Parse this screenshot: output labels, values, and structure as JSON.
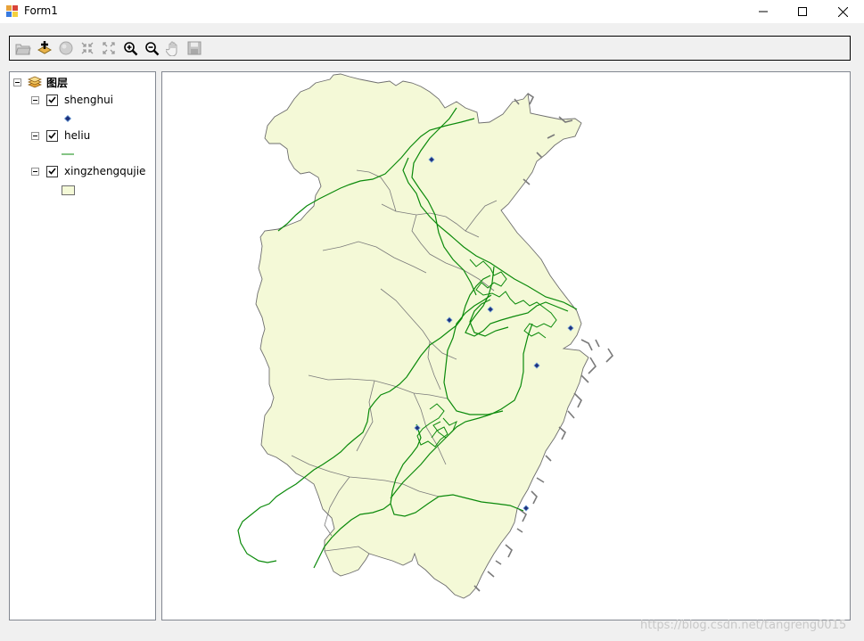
{
  "window": {
    "title": "Form1",
    "controls": {
      "minimize": "minimize",
      "maximize": "maximize",
      "close": "close"
    }
  },
  "toolbar": {
    "tools": [
      {
        "name": "open-document-icon"
      },
      {
        "name": "add-data-icon"
      },
      {
        "name": "globe-icon"
      },
      {
        "name": "fixed-zoom-in-icon"
      },
      {
        "name": "fixed-zoom-out-icon"
      },
      {
        "name": "zoom-in-icon"
      },
      {
        "name": "zoom-out-icon"
      },
      {
        "name": "pan-hand-icon"
      },
      {
        "name": "save-icon"
      }
    ]
  },
  "toc": {
    "root_label": "图层",
    "layers": [
      {
        "label": "shenghui",
        "checked": true,
        "symbol": "point"
      },
      {
        "label": "heliu",
        "checked": true,
        "symbol": "line"
      },
      {
        "label": "xingzhengqujie",
        "checked": true,
        "symbol": "polygon"
      }
    ]
  },
  "map": {
    "colors": {
      "polygon_fill": "#f4f9d7",
      "polygon_outline": "#6e6e6e",
      "river": "#0b8a0b",
      "point_fill": "#1f2f7a"
    }
  },
  "watermark": "https://blog.csdn.net/tangreng0015"
}
